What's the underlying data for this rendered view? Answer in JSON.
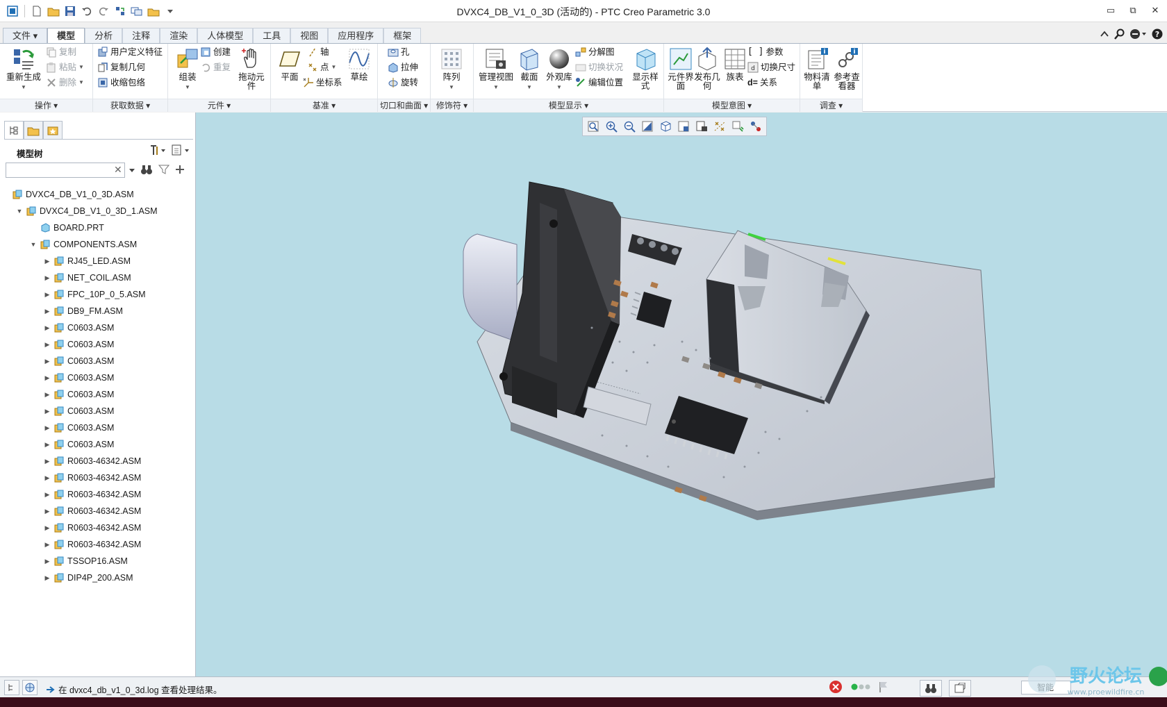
{
  "window": {
    "title": "DVXC4_DB_V1_0_3D (活动的) - PTC Creo Parametric 3.0",
    "minimize": "▭",
    "restore": "⧉",
    "close": "✕"
  },
  "tabs": [
    {
      "label": "文件 ▾"
    },
    {
      "label": "模型"
    },
    {
      "label": "分析"
    },
    {
      "label": "注释"
    },
    {
      "label": "渲染"
    },
    {
      "label": "人体模型"
    },
    {
      "label": "工具"
    },
    {
      "label": "视图"
    },
    {
      "label": "应用程序"
    },
    {
      "label": "框架"
    }
  ],
  "ribbon": {
    "groups": {
      "operations": "操作 ▾",
      "get_data": "获取数据 ▾",
      "component": "元件 ▾",
      "datum": "基准 ▾",
      "cut_surface": "切口和曲面 ▾",
      "modifiers": "修饰符 ▾",
      "model_display": "模型显示 ▾",
      "model_intent": "模型意图 ▾",
      "investigate": "调查 ▾"
    },
    "regenerate": "重新生成",
    "copy": "复制",
    "paste": "粘贴",
    "delete": "删除",
    "user_feature": "用户定义特征",
    "copy_geometry": "复制几何",
    "shrinkwrap": "收缩包络",
    "assemble": "组装",
    "create": "创建",
    "repeat": "重复",
    "drag": "拖动元件",
    "plane": "平面",
    "axis": "轴",
    "point": "点",
    "csys": "坐标系",
    "sketch": "草绘",
    "hole": "孔",
    "extrude": "拉伸",
    "revolve": "旋转",
    "pattern": "阵列",
    "manage_views": "管理视图",
    "section": "截面",
    "appearance": "外观库",
    "exploded": "分解图",
    "toggle_status": "切换状况",
    "edit_position": "编辑位置",
    "display_style": "显示样式",
    "comp_interface": "元件界面",
    "publish_geom": "发布几何",
    "family_table": "族表",
    "parameters": "参数",
    "switch_dims": "切换尺寸",
    "relations": "关系",
    "bom": "物料清单",
    "ref_viewer": "参考查看器"
  },
  "tree": {
    "title": "模型树",
    "search_placeholder": "",
    "items": [
      {
        "label": "DVXC4_DB_V1_0_3D.ASM"
      },
      {
        "label": "DVXC4_DB_V1_0_3D_1.ASM"
      },
      {
        "label": "BOARD.PRT"
      },
      {
        "label": "COMPONENTS.ASM"
      },
      {
        "label": "RJ45_LED.ASM"
      },
      {
        "label": "NET_COIL.ASM"
      },
      {
        "label": "FPC_10P_0_5.ASM"
      },
      {
        "label": "DB9_FM.ASM"
      },
      {
        "label": "C0603.ASM"
      },
      {
        "label": "C0603.ASM"
      },
      {
        "label": "C0603.ASM"
      },
      {
        "label": "C0603.ASM"
      },
      {
        "label": "C0603.ASM"
      },
      {
        "label": "C0603.ASM"
      },
      {
        "label": "C0603.ASM"
      },
      {
        "label": "C0603.ASM"
      },
      {
        "label": "R0603-46342.ASM"
      },
      {
        "label": "R0603-46342.ASM"
      },
      {
        "label": "R0603-46342.ASM"
      },
      {
        "label": "R0603-46342.ASM"
      },
      {
        "label": "R0603-46342.ASM"
      },
      {
        "label": "R0603-46342.ASM"
      },
      {
        "label": "TSSOP16.ASM"
      },
      {
        "label": "DIP4P_200.ASM"
      }
    ]
  },
  "status": {
    "message": "在 dvxc4_db_v1_0_3d.log 查看处理结果。",
    "filter": "智能"
  },
  "watermark": {
    "name": "野火论坛",
    "url": "www.proewildfire.cn"
  },
  "colors": {
    "viewport_bg": "#b8dce6",
    "accent": "#1f6fb5",
    "pcb": "#c6cbd4"
  }
}
